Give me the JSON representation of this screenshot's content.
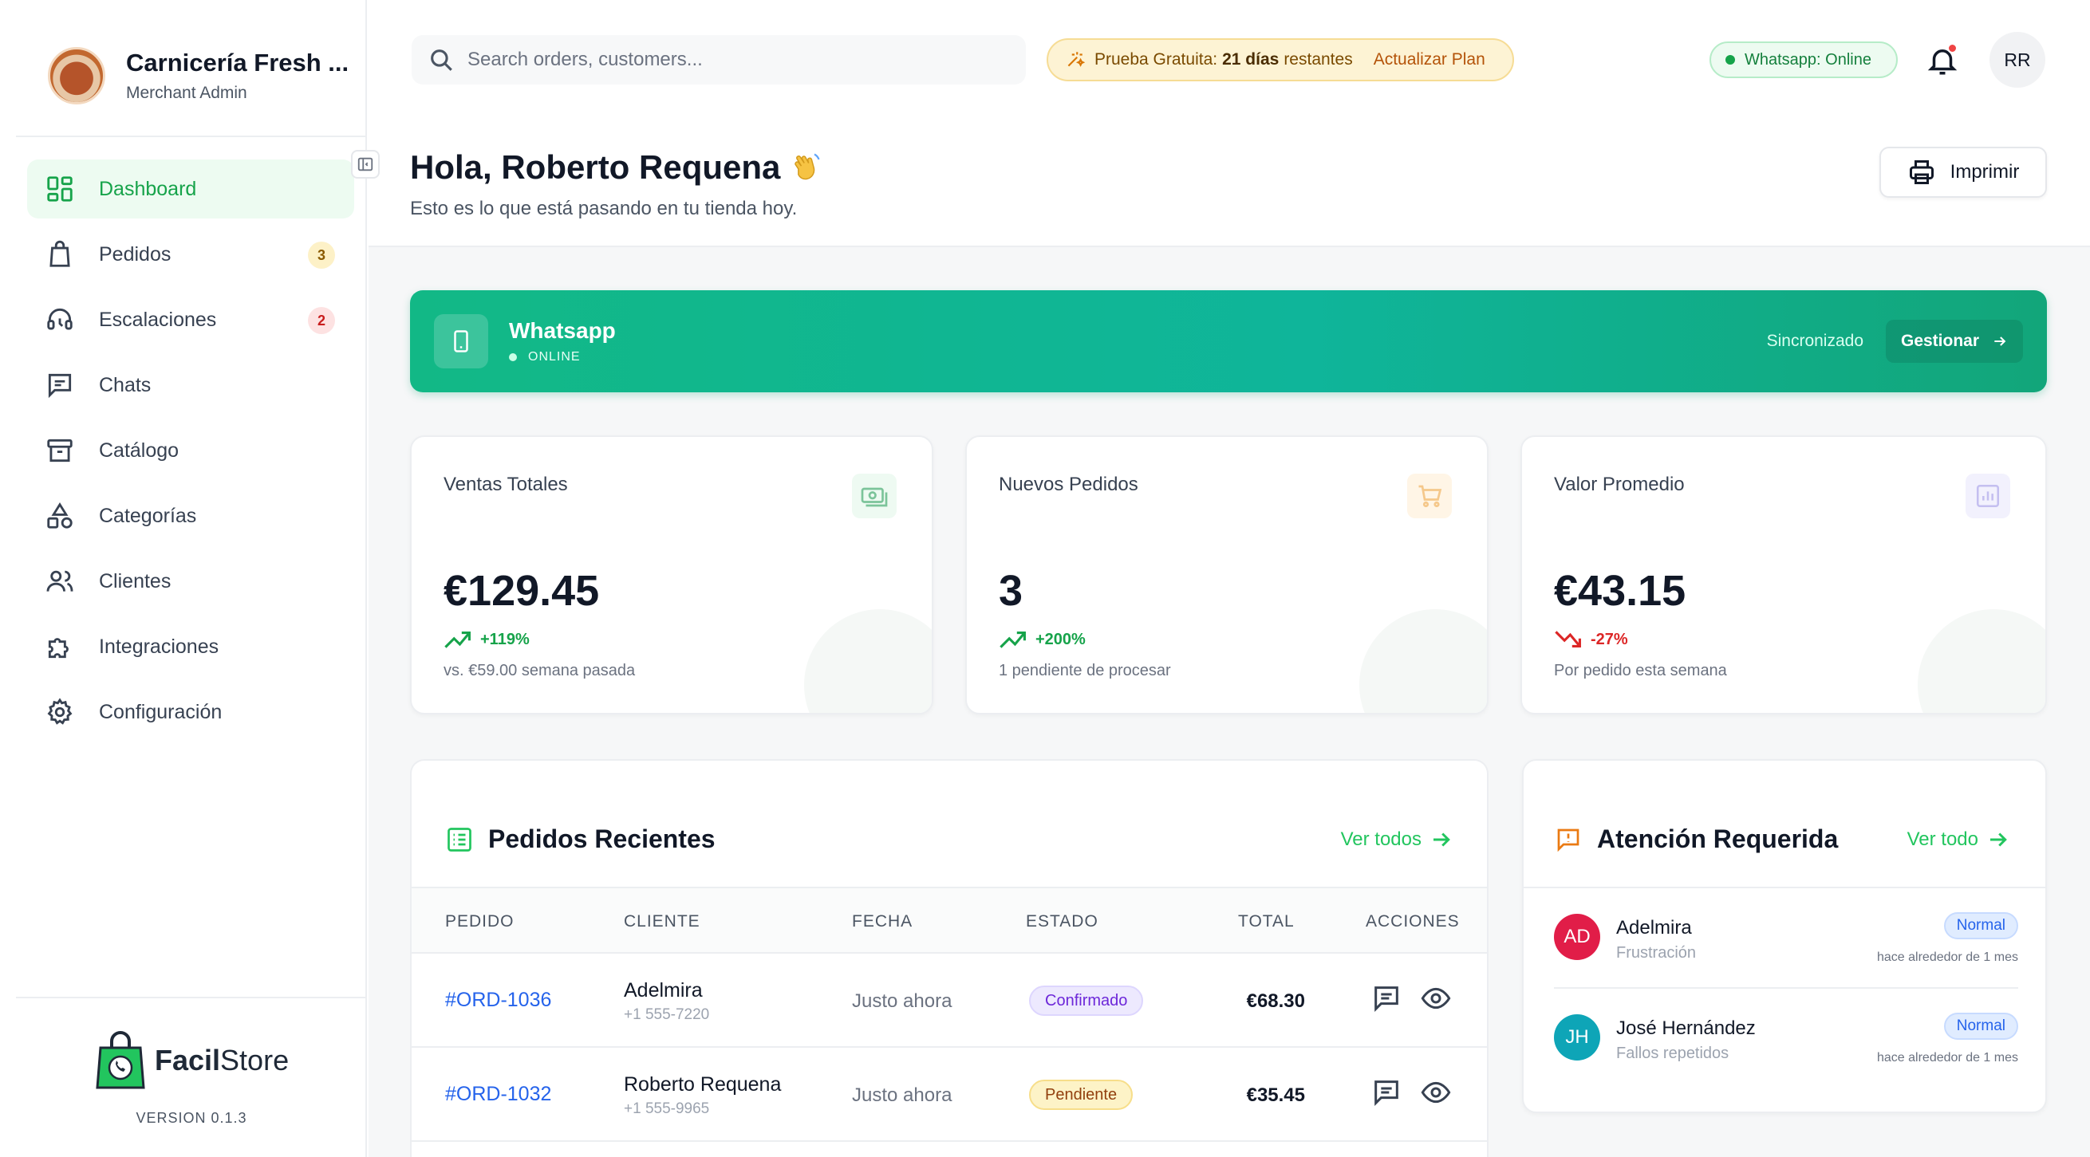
{
  "sidebar": {
    "store_name": "Carnicería Fresh ...",
    "role": "Merchant Admin",
    "nav": [
      {
        "label": "Dashboard",
        "icon": "dashboard-icon",
        "active": true
      },
      {
        "label": "Pedidos",
        "icon": "shopping-bag-icon",
        "badge": "3"
      },
      {
        "label": "Escalaciones",
        "icon": "headset-icon",
        "badge": "2"
      },
      {
        "label": "Chats",
        "icon": "chat-icon"
      },
      {
        "label": "Catálogo",
        "icon": "archive-icon"
      },
      {
        "label": "Categorías",
        "icon": "shapes-icon"
      },
      {
        "label": "Clientes",
        "icon": "users-icon"
      },
      {
        "label": "Integraciones",
        "icon": "puzzle-icon"
      },
      {
        "label": "Configuración",
        "icon": "gear-icon"
      }
    ],
    "footer": {
      "brand_bold": "Facil",
      "brand_light": "Store",
      "version": "VERSION 0.1.3"
    }
  },
  "topbar": {
    "search_placeholder": "Search orders, customers...",
    "trial": {
      "prefix": "Prueba Gratuita:",
      "days": "21 días",
      "suffix": "restantes",
      "upgrade": "Actualizar Plan"
    },
    "whatsapp_status": "Whatsapp: Online",
    "avatar_initials": "RR"
  },
  "greeting": {
    "title": "Hola, Roberto Requena",
    "subtitle": "Esto es lo que está pasando en tu tienda hoy.",
    "print_label": "Imprimir"
  },
  "whatsapp_banner": {
    "title": "Whatsapp",
    "status": "ONLINE",
    "sync_text": "Sincronizado",
    "manage_label": "Gestionar"
  },
  "stats": [
    {
      "label": "Ventas Totales",
      "value": "€129.45",
      "change": "+119%",
      "trend": "up",
      "note": "vs. €59.00 semana pasada",
      "icon": "money-icon",
      "color": "#16a34a"
    },
    {
      "label": "Nuevos Pedidos",
      "value": "3",
      "change": "+200%",
      "trend": "up",
      "note": "1 pendiente de procesar",
      "icon": "cart-icon",
      "color": "#16a34a"
    },
    {
      "label": "Valor Promedio",
      "value": "€43.15",
      "change": "-27%",
      "trend": "down",
      "note": "Por pedido esta semana",
      "icon": "bar-chart-icon",
      "color": "#dc2626"
    }
  ],
  "orders": {
    "title": "Pedidos Recientes",
    "see_all": "Ver todos",
    "columns": [
      "PEDIDO",
      "CLIENTE",
      "FECHA",
      "ESTADO",
      "TOTAL",
      "ACCIONES"
    ],
    "rows": [
      {
        "id": "#ORD-1036",
        "customer": "Adelmira",
        "phone": "+1 555-7220",
        "date": "Justo ahora",
        "status": "Confirmado",
        "total": "€68.30"
      },
      {
        "id": "#ORD-1032",
        "customer": "Roberto Requena",
        "phone": "+1 555-9965",
        "date": "Justo ahora",
        "status": "Pendiente",
        "total": "€35.45"
      }
    ]
  },
  "attention": {
    "title": "Atención Requerida",
    "see_all": "Ver todo",
    "items": [
      {
        "initials": "AD",
        "name": "Adelmira",
        "reason": "Frustración",
        "level": "Normal",
        "time": "hace alrededor de 1 mes",
        "color": "#e11d48"
      },
      {
        "initials": "JH",
        "name": "José Hernández",
        "reason": "Fallos repetidos",
        "level": "Normal",
        "time": "hace alrededor de 1 mes",
        "color": "#0ea5b7"
      }
    ]
  },
  "colors": {
    "accent": "#16a34a",
    "whatsapp": "#12b886",
    "link": "#2563eb"
  }
}
